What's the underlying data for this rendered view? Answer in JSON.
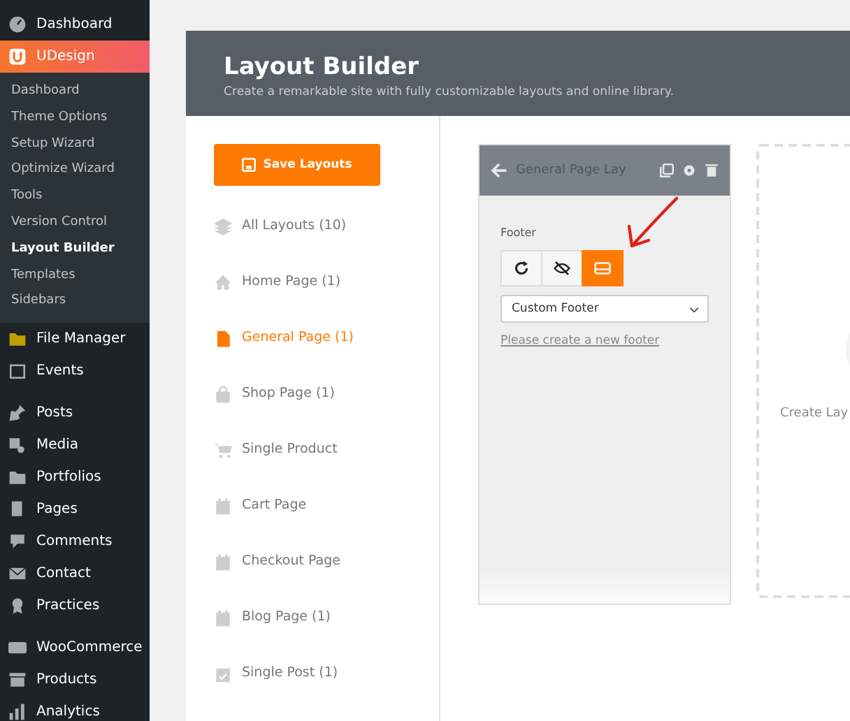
{
  "admin_menu": {
    "sections": [
      {
        "items": [
          {
            "label": "Dashboard",
            "selected": false
          },
          {
            "label": "UDesign",
            "selected": true,
            "children": [
              {
                "label": "Dashboard",
                "selected": false
              },
              {
                "label": "Theme Options",
                "selected": false
              },
              {
                "label": "Setup Wizard",
                "selected": false
              },
              {
                "label": "Optimize Wizard",
                "selected": false
              },
              {
                "label": "Tools",
                "selected": false
              },
              {
                "label": "Version Control",
                "selected": false
              },
              {
                "label": "Layout Builder",
                "selected": true
              },
              {
                "label": "Templates",
                "selected": false
              },
              {
                "label": "Sidebars",
                "selected": false
              }
            ]
          },
          {
            "label": "File Manager",
            "selected": false
          },
          {
            "label": "Events",
            "selected": false
          }
        ]
      },
      {
        "items": [
          {
            "label": "Posts",
            "selected": false
          },
          {
            "label": "Media",
            "selected": false
          },
          {
            "label": "Portfolios",
            "selected": false
          },
          {
            "label": "Pages",
            "selected": false
          },
          {
            "label": "Comments",
            "selected": false
          },
          {
            "label": "Contact",
            "selected": false
          },
          {
            "label": "Practices",
            "selected": false
          }
        ]
      },
      {
        "items": [
          {
            "label": "WooCommerce",
            "selected": false
          },
          {
            "label": "Products",
            "selected": false
          },
          {
            "label": "Analytics",
            "selected": false
          }
        ]
      }
    ]
  },
  "header": {
    "title": "Layout Builder",
    "subtitle": "Create a remarkable site with fully customizable layouts and online library."
  },
  "save_button": "Save Layouts",
  "layout_types": [
    {
      "label": "All Layouts",
      "count": "(10)",
      "selected": false
    },
    {
      "label": "Home Page",
      "count": "(1)",
      "selected": false
    },
    {
      "label": "General Page",
      "count": "(1)",
      "selected": true
    },
    {
      "label": "Shop Page",
      "count": "(1)",
      "selected": false
    },
    {
      "label": "Single Product",
      "selected": false
    },
    {
      "label": "Cart Page",
      "selected": false
    },
    {
      "label": "Checkout Page",
      "selected": false
    },
    {
      "label": "Blog Page",
      "count": "(1)",
      "selected": false
    },
    {
      "label": "Single Post",
      "count": "(1)",
      "selected": false
    }
  ],
  "layout_card": {
    "title": "General Page Lay",
    "field_label": "Footer",
    "modes": [
      {
        "selected": false
      },
      {
        "selected": false
      },
      {
        "selected": true
      }
    ],
    "select": {
      "value": "Custom Footer"
    },
    "link": "Please create a new footer"
  },
  "new_layout_card": {
    "text": "Create Lay"
  }
}
